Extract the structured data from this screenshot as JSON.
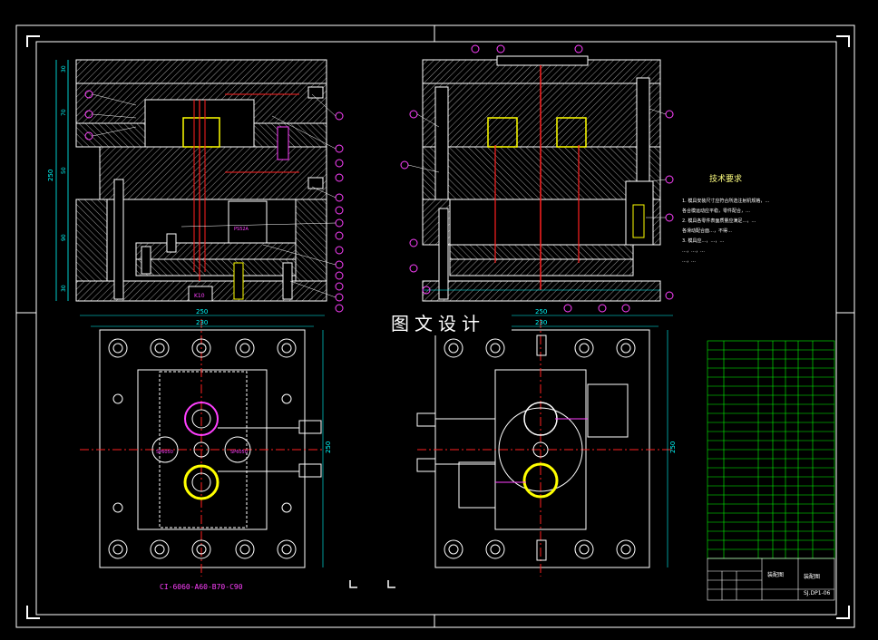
{
  "watermark": "图文设计",
  "tech_requirements": {
    "title": "技术要求",
    "lines": [
      "1. 模具安装尺寸应符合所选注射机规格，…",
      "各合模运动应平稳，零件配合，…",
      "2. 模具各零件表面质量应满足…，…",
      "各滑动配合面…，不得…",
      "3. 模具应…，…，…",
      "…，…，…",
      "…，…"
    ]
  },
  "dimensions": {
    "top_left_total": "250",
    "top_left_left": [
      "30",
      "70",
      "50",
      "90",
      "30"
    ],
    "bottom_left_width_outer": "250",
    "bottom_left_width_inner": "230",
    "bottom_left_height": "250",
    "bottom_right_width_outer": "250",
    "bottom_right_width_inner": "230",
    "bottom_right_height": "250",
    "bl_label_a": "SP6050",
    "bl_label_b": "SP6050",
    "tl_part_label": "PS52A",
    "tl_bottom_label": "K10"
  },
  "mold_code": "CI-6060-A60-B70-C90",
  "title_block": {
    "name": "装配图",
    "drawing": "装配图",
    "number": "SJ.DP1-06"
  },
  "colors": {
    "background": "#000000",
    "outline": "#ffffff",
    "hatch": "#c0c0c0",
    "dimension": "#00ffff",
    "centerline": "#ff2020",
    "balloon": "#ff00ff",
    "part": "#ffff00",
    "bom": "#00ff00"
  }
}
